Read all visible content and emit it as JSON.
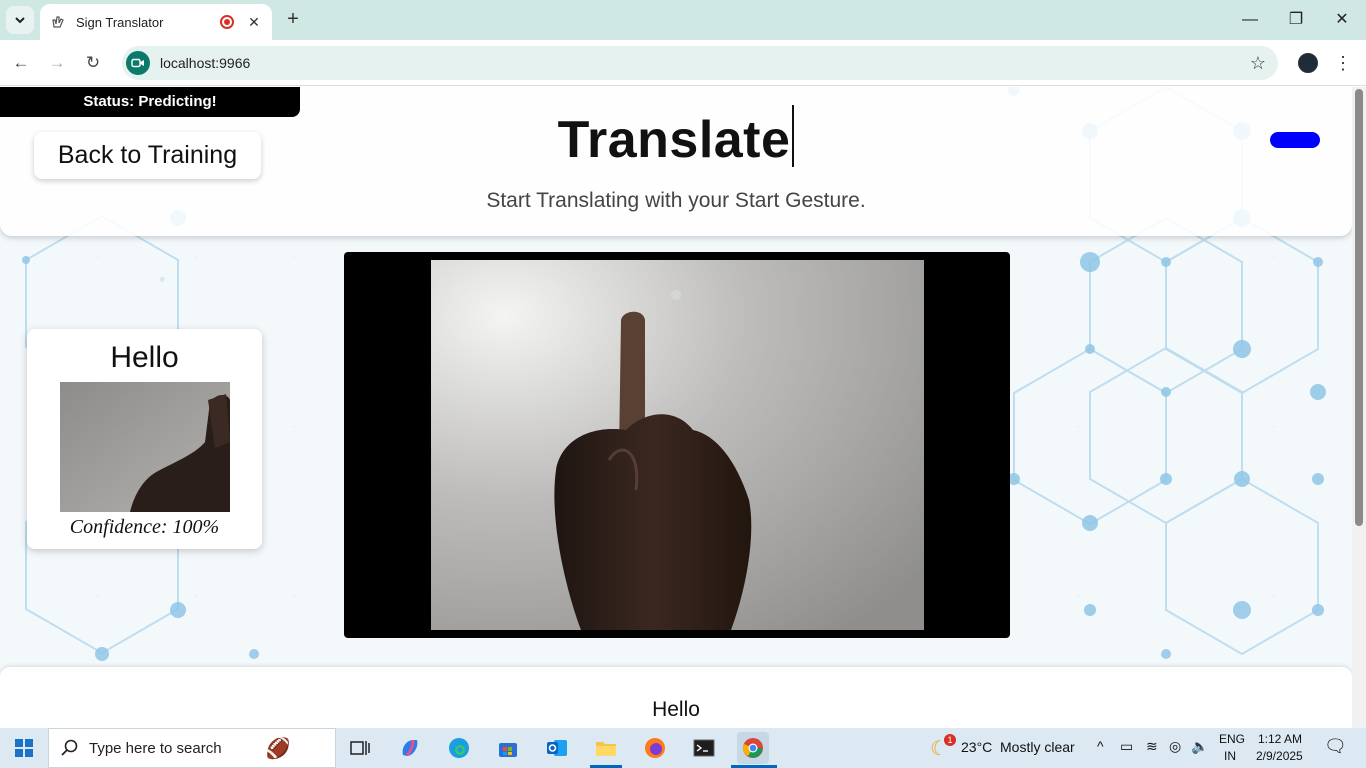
{
  "browser": {
    "tab_title": "Sign Translator",
    "url": "localhost:9966",
    "tab_close": "✕",
    "new_tab": "+"
  },
  "page": {
    "status": "Status: Predicting!",
    "back_button": "Back to Training",
    "title": "Translate",
    "subtitle": "Start Translating with your Start Gesture.",
    "prediction": {
      "word": "Hello",
      "confidence": "Confidence: 100%"
    },
    "output_text": "Hello"
  },
  "taskbar": {
    "search_placeholder": "Type here to search",
    "weather_temp": "23°C",
    "weather_desc": "Mostly clear",
    "weather_badge": "1",
    "lang_line1": "ENG",
    "lang_line2": "IN",
    "time": "1:12 AM",
    "date": "2/9/2025"
  },
  "colors": {
    "accent_blue": "#0000ff",
    "tabstrip": "#cfe8e4",
    "taskbar": "#dce9f2"
  }
}
